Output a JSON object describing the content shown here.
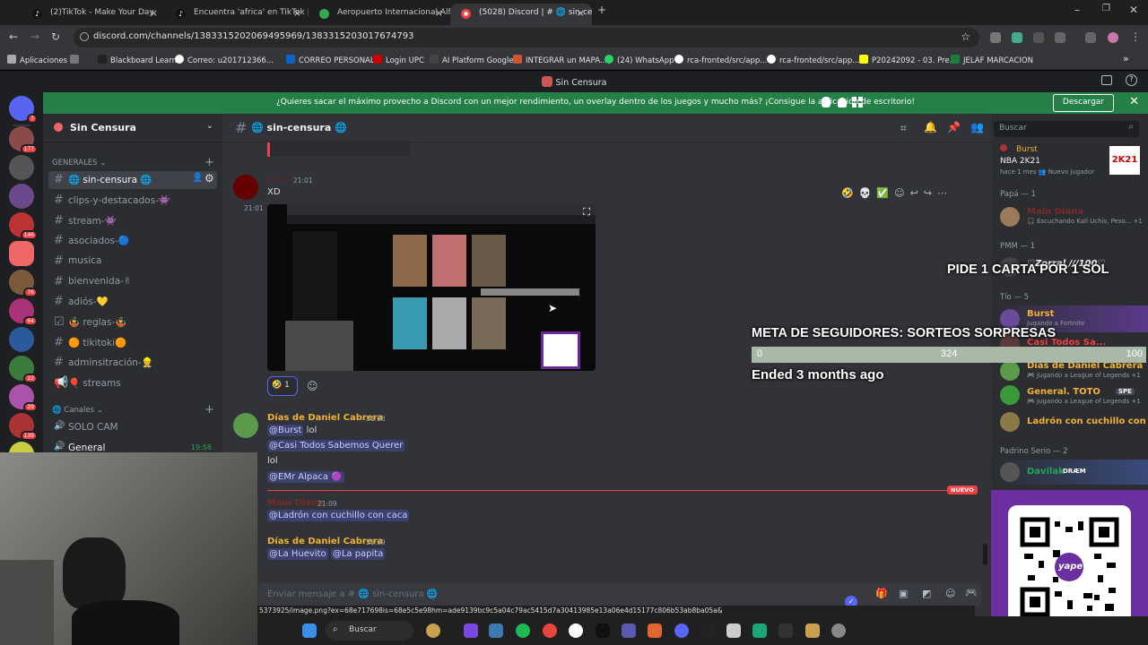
{
  "browser": {
    "tabs": [
      {
        "label": "(2)TikTok - Make Your Day"
      },
      {
        "label": "Encuentra 'africa' en TikTok | Bu"
      },
      {
        "label": "Aeropuerto Internacional Alfre"
      },
      {
        "label": "(5028) Discord | # 🌐 sin-ce"
      }
    ],
    "url": "discord.com/channels/1383315202069495969/1383315203017674793",
    "bookmarks": [
      "Aplicaciones",
      "Blackboard Learn",
      "Correo: u201712366...",
      "CORREO PERSONAL",
      "Login UPC",
      "AI Platform Google",
      "INTEGRAR un MAPA...",
      "(24) WhatsApp",
      "rca-fronted/src/app...",
      "rca-fronted/src/app...",
      "P20242092 - 03. Pre...",
      "JELAF MARCACION"
    ]
  },
  "discord": {
    "window_title": "Sin Censura",
    "banner_text": "¿Quieres sacar el máximo provecho a Discord con un mejor rendimiento, un overlay dentro de los juegos y mucho más? ¡Consigue la aplicación de escritorio!",
    "banner_button": "Descargar",
    "server_badges": [
      "7",
      "177",
      "146",
      "76",
      "64",
      "22",
      "29",
      "139"
    ],
    "server_name": "Sin Censura",
    "category_generales": "GENERALES",
    "category_canales": "Canales",
    "channels": [
      {
        "label": "🌐 sin-censura 🌐"
      },
      {
        "label": "clips-y-destacados-👾"
      },
      {
        "label": "stream-👾"
      },
      {
        "label": "asociados-🔵"
      },
      {
        "label": "musica"
      },
      {
        "label": "bienvenida-✌"
      },
      {
        "label": "adiós-💛"
      },
      {
        "label": "🤹 reglas-🤹"
      },
      {
        "label": "🟠 tikitoki🟠"
      },
      {
        "label": "adminsitración-👷"
      },
      {
        "label": "🎈 streams"
      }
    ],
    "voice_channels": [
      {
        "label": "SOLO CAM"
      },
      {
        "label": "General",
        "time": "19:58"
      }
    ],
    "chat_header": "🌐 sin-censura 🌐",
    "search_placeholder": "Buscar",
    "messages": {
      "m1": {
        "author": "Anal",
        "time": "21:01",
        "text": "XD",
        "side_time": "21:01",
        "reaction_count": "1"
      },
      "m2": {
        "author": "Días de Daniel Cabrera",
        "time": "21:08",
        "line1_mention": "@Burst",
        "line1_text": "lol",
        "line2_mention": "@Casi Todos Sabemos Querer",
        "line3": "lol",
        "line4_mention": "@EMr Alpaca 🟣"
      },
      "new_label": "NUEVO",
      "m3": {
        "author": "Maiu Diana",
        "time": "21:09",
        "mention": "@Ladrón con cuchillo con caca"
      },
      "m4": {
        "author": "Días de Daniel Cabrera",
        "time": "21:09",
        "mention1": "@La Huevito",
        "mention2": "@La papita"
      }
    },
    "composer_placeholder": "Enviar mensaje a # 🌐 sin-censura 🌐",
    "link_preview": "5373925/image.png?ex=68e717698is=68e5c5e98hm=ade9139bc9c5a04c79ac5415d7a30413985e13a06e4d15177c806b53ab8ba05a&",
    "members": {
      "activity_name": "Burst",
      "activity_game": "NBA 2K21",
      "activity_meta": "hace 1 mes  👥 Nuevo jugador",
      "cat_papa": "Papá — 1",
      "m_main": "Main Diana",
      "m_main_sub": "🎧 Escuchando Kali Uchis, Peso... +1",
      "cat_pmm": "PMM — 1",
      "m_zorral": "♡Zorral ///100♡",
      "cat_tio": "Tío — 5",
      "m_burst": "Burst",
      "m_burst_sub": "Jugando a Fortnite",
      "m_casi": "Casi Todos Sa...",
      "m_dias": "Días de Daniel Cabrera",
      "m_dias_sub": "🎮 Jugando a League of Legends +1",
      "m_toto": "General. TOTO",
      "m_toto_tag": "SPE",
      "m_toto_sub": "🎮 Jugando a League of Legends +1",
      "m_ladron": "Ladrón con cuchillo con c...",
      "cat_padrino": "Padrino Serio — 2",
      "m_davilak": "Davilak",
      "m_davilak_tag": "DRÆM"
    }
  },
  "overlay": {
    "pide": "PIDE 1 CARTA POR 1 SOL",
    "meta_title": "META DE SEGUIDORES: SORTEOS SORPRESAS",
    "progress_start": "0",
    "progress_mid": "324",
    "progress_end": "100",
    "progress_fraction": 1.0,
    "ended": "Ended 3 months ago",
    "yape_label": "yape"
  },
  "taskbar": {
    "search": "Buscar"
  }
}
